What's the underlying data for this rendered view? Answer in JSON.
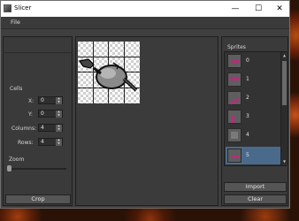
{
  "window": {
    "title": "Slicer",
    "controls": {
      "minimize": "—",
      "maximize": "☐",
      "close": "✕"
    }
  },
  "menu": {
    "file": "File"
  },
  "cells": {
    "title": "Cells",
    "x_label": "X:",
    "x_value": "0",
    "y_label": "Y:",
    "y_value": "0",
    "columns_label": "Columns:",
    "columns_value": "4",
    "rows_label": "Rows:",
    "rows_value": "4"
  },
  "zoom": {
    "title": "Zoom",
    "level": 0.0
  },
  "buttons": {
    "crop": "Crop",
    "import": "Import",
    "clear": "Clear"
  },
  "sprites": {
    "title": "Sprites",
    "items": [
      {
        "label": "0",
        "selected": false
      },
      {
        "label": "1",
        "selected": false
      },
      {
        "label": "2",
        "selected": false
      },
      {
        "label": "3",
        "selected": false
      },
      {
        "label": "4",
        "selected": false
      },
      {
        "label": "5",
        "selected": true
      }
    ]
  },
  "colors": {
    "accent": "#4a6a8c",
    "sprite_highlight": "#b0307a"
  }
}
